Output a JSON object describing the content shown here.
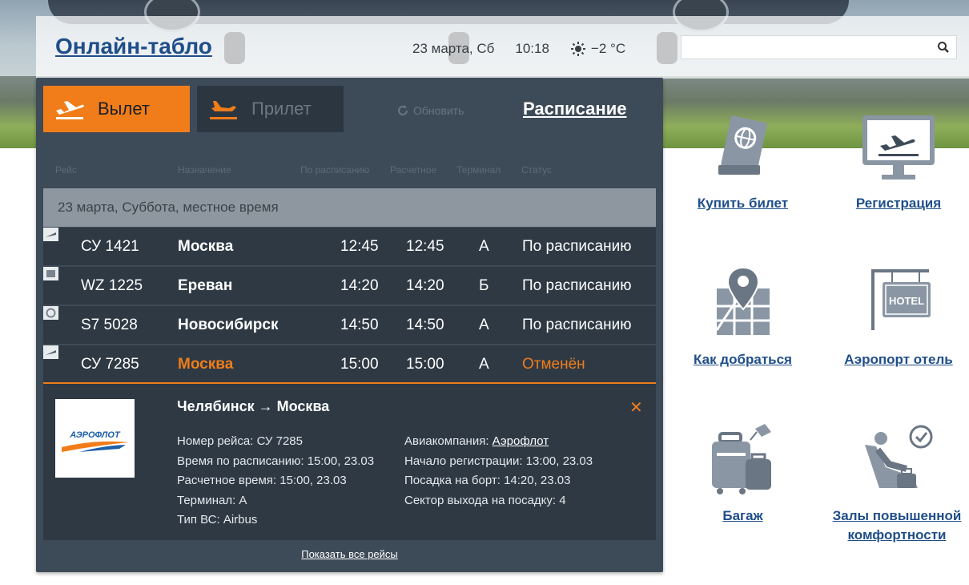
{
  "header": {
    "site_title": "Онлайн-табло",
    "date": "23 марта, Сб",
    "time": "10:18",
    "temperature": "−2 °C",
    "search_placeholder": ""
  },
  "board": {
    "tab_departure": "Вылет",
    "tab_arrival": "Прилет",
    "refresh_label": "Обновить",
    "schedule_link": "Расписание",
    "columns": [
      "Рейс",
      "Назначение",
      "По расписанию",
      "Расчетное",
      "Терминал",
      "Статус"
    ],
    "date_banner": "23 марта, Суббота, местное время",
    "rows": [
      {
        "flight": "СУ 1421",
        "destination": "Москва",
        "scheduled": "12:45",
        "estimated": "12:45",
        "terminal": "A",
        "status": "По расписанию"
      },
      {
        "flight": "WZ 1225",
        "destination": "Ереван",
        "scheduled": "14:20",
        "estimated": "14:20",
        "terminal": "Б",
        "status": "По расписанию"
      },
      {
        "flight": "S7 5028",
        "destination": "Новосибирск",
        "scheduled": "14:50",
        "estimated": "14:50",
        "terminal": "A",
        "status": "По расписанию"
      },
      {
        "flight": "СУ 7285",
        "destination": "Москва",
        "scheduled": "15:00",
        "estimated": "15:00",
        "terminal": "A",
        "status": "Отменён"
      }
    ],
    "detail": {
      "logo_text": "АЭРОФЛОТ",
      "route": "Челябинск → Москва",
      "flight_number": "Номер рейса: СУ 7285",
      "scheduled_time": "Время по расписанию: 15:00, 23.03",
      "estimated_time": "Расчетное время: 15:00, 23.03",
      "terminal": "Терминал: A",
      "aircraft": "Тип ВС: Airbus",
      "airline_label": "Авиакомпания:",
      "airline_name": "Аэрофлот",
      "checkin_start": "Начало регистрации: 13:00, 23.03",
      "boarding": "Посадка на борт: 14:20, 23.03",
      "gate": "Сектор выхода на посадку: 4"
    },
    "show_all": "Показать все рейсы"
  },
  "services": {
    "buy_ticket": "Купить билет",
    "checkin": "Регистрация",
    "directions": "Как добраться",
    "hotel": "Аэропорт отель",
    "hotel_sign": "HOTEL",
    "baggage": "Багаж",
    "lounges": "Залы повышенной комфортности"
  },
  "colors": {
    "accent": "#f07d1a",
    "panel": "#3d4a58",
    "row": "#2e3944",
    "link": "#1f4e8a",
    "icon": "#8a96a4"
  }
}
